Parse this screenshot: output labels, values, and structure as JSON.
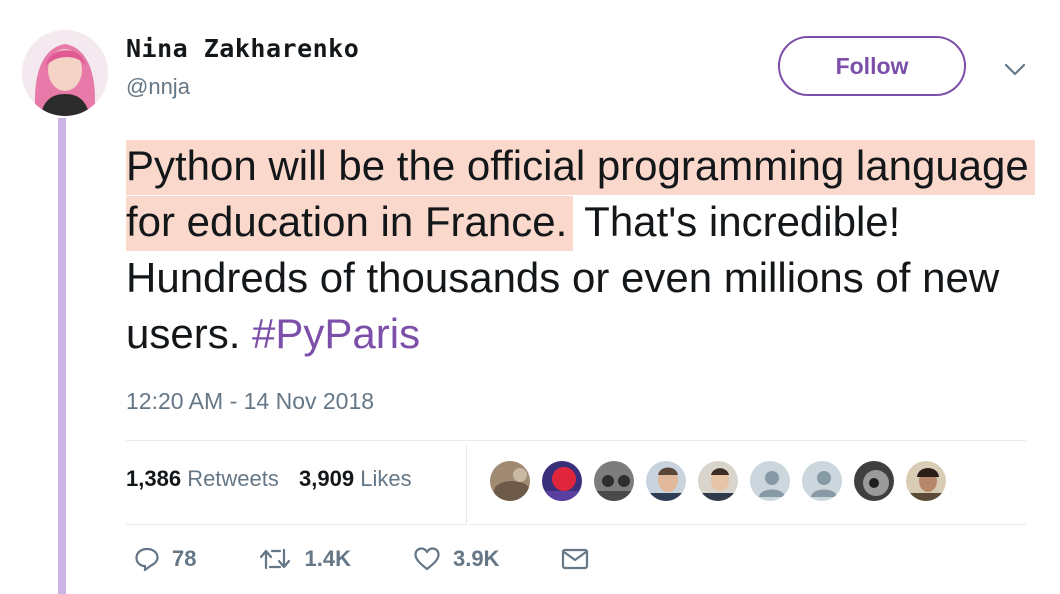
{
  "author": {
    "name": "Nina Zakharenko",
    "handle": "@nnja"
  },
  "follow_label": "Follow",
  "tweet": {
    "highlighted_text": "Python will be the official programming language for education in France.",
    "text_rest": " That's incredible! Hundreds of thousands or even millions of new users. ",
    "hashtag": "#PyParis",
    "timestamp": "12:20 AM - 14 Nov 2018"
  },
  "stats": {
    "retweets_count": "1,386",
    "retweets_label": "Retweets",
    "likes_count": "3,909",
    "likes_label": "Likes"
  },
  "liked_by_avatars": 9,
  "actions": {
    "reply_count": "78",
    "retweet_count": "1.4K",
    "like_count": "3.9K"
  },
  "colors": {
    "accent": "#7c4fa8",
    "highlight": "#fad8cc",
    "thread_line": "#cfb5e6",
    "secondary_text": "#657786"
  }
}
